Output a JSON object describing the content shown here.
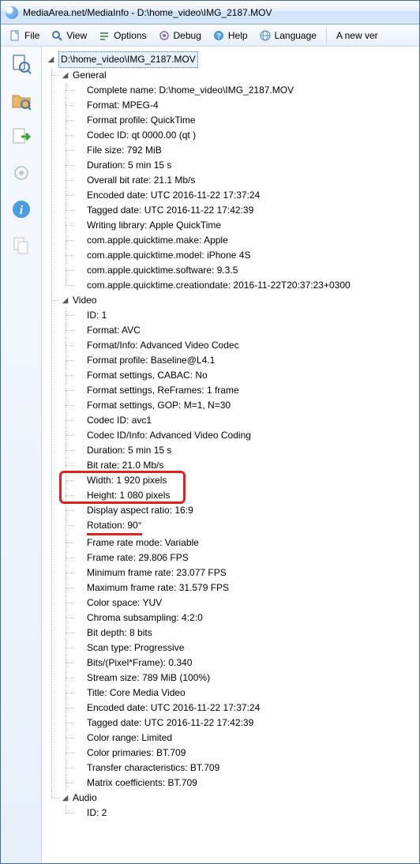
{
  "titlebar": {
    "title": "MediaArea.net/MediaInfo - D:\\home_video\\IMG_2187.MOV"
  },
  "menu": {
    "file": "File",
    "view": "View",
    "options": "Options",
    "debug": "Debug",
    "help": "Help",
    "language": "Language",
    "newver": "A new ver"
  },
  "tree": {
    "root": "D:\\home_video\\IMG_2187.MOV",
    "general": {
      "label": "General",
      "items": [
        "Complete name: D:\\home_video\\IMG_2187.MOV",
        "Format: MPEG-4",
        "Format profile: QuickTime",
        "Codec ID: qt   0000.00 (qt  )",
        "File size: 792 MiB",
        "Duration: 5 min 15 s",
        "Overall bit rate: 21.1 Mb/s",
        "Encoded date: UTC 2016-11-22 17:37:24",
        "Tagged date: UTC 2016-11-22 17:42:39",
        "Writing library: Apple QuickTime",
        "com.apple.quicktime.make: Apple",
        "com.apple.quicktime.model: iPhone 4S",
        "com.apple.quicktime.software: 9.3.5",
        "com.apple.quicktime.creationdate: 2016-11-22T20:37:23+0300"
      ]
    },
    "video": {
      "label": "Video",
      "items": [
        "ID: 1",
        "Format: AVC",
        "Format/Info: Advanced Video Codec",
        "Format profile: Baseline@L4.1",
        "Format settings, CABAC: No",
        "Format settings, ReFrames: 1 frame",
        "Format settings, GOP: M=1, N=30",
        "Codec ID: avc1",
        "Codec ID/Info: Advanced Video Coding",
        "Duration: 5 min 15 s",
        "Bit rate: 21.0 Mb/s",
        "Width: 1 920 pixels",
        "Height: 1 080 pixels",
        "Display aspect ratio: 16:9",
        "Rotation: 90°",
        "Frame rate mode: Variable",
        "Frame rate: 29.806 FPS",
        "Minimum frame rate: 23.077 FPS",
        "Maximum frame rate: 31.579 FPS",
        "Color space: YUV",
        "Chroma subsampling: 4:2:0",
        "Bit depth: 8 bits",
        "Scan type: Progressive",
        "Bits/(Pixel*Frame): 0.340",
        "Stream size: 789 MiB (100%)",
        "Title: Core Media Video",
        "Encoded date: UTC 2016-11-22 17:37:24",
        "Tagged date: UTC 2016-11-22 17:42:39",
        "Color range: Limited",
        "Color primaries: BT.709",
        "Transfer characteristics: BT.709",
        "Matrix coefficients: BT.709"
      ]
    },
    "audio": {
      "label": "Audio",
      "items": [
        "ID: 2"
      ]
    }
  }
}
